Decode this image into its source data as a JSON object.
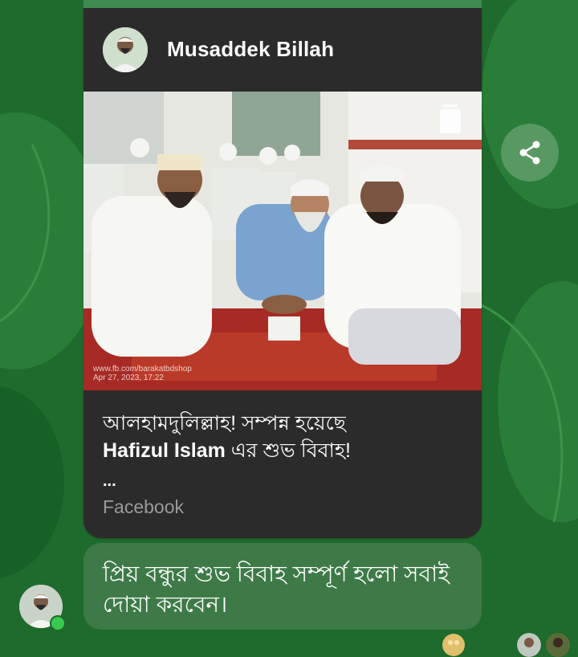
{
  "post": {
    "author": "Musaddek Billah",
    "watermark_line1": "www.fb.com/barakatbdshop",
    "watermark_line2": "Apr 27, 2023, 17:22",
    "caption_line1": "আলহামদুলিল্লাহ! সম্পন্ন হয়েছে",
    "caption_name": "Hafizul Islam",
    "caption_rest": " এর শুভ বিবাহ!",
    "ellipsis": "...",
    "source": "Facebook"
  },
  "message": {
    "text": "প্রিয় বন্ধুর শুভ বিবাহ সম্পূর্ণ হলো সবাই দোয়া করবেন।"
  },
  "icons": {
    "share": "share-icon",
    "photo_badge": "document-icon",
    "online": "online-dot"
  },
  "colors": {
    "background": "#1f6a2d",
    "card": "#2b2b2b",
    "message_bubble": "#3d7a48",
    "online": "#39c94d"
  }
}
